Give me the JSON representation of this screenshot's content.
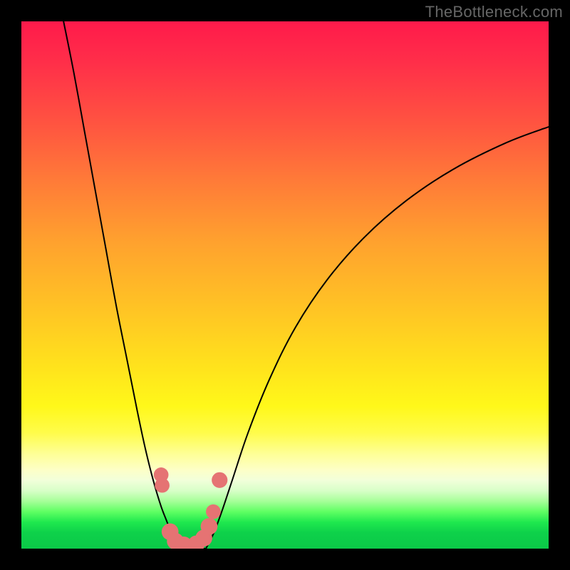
{
  "watermark": "TheBottleneck.com",
  "chart_data": {
    "type": "line",
    "title": "",
    "xlabel": "",
    "ylabel": "",
    "xlim": [
      0,
      100
    ],
    "ylim": [
      0,
      100
    ],
    "grid": false,
    "legend": false,
    "gradient_stops": [
      {
        "pos": 0,
        "color": "#ff1a4b"
      },
      {
        "pos": 8,
        "color": "#ff2f49"
      },
      {
        "pos": 20,
        "color": "#ff5640"
      },
      {
        "pos": 30,
        "color": "#ff7a38"
      },
      {
        "pos": 42,
        "color": "#ffa22e"
      },
      {
        "pos": 55,
        "color": "#ffc524"
      },
      {
        "pos": 66,
        "color": "#ffe41c"
      },
      {
        "pos": 73,
        "color": "#fff81a"
      },
      {
        "pos": 78,
        "color": "#fffc4a"
      },
      {
        "pos": 82,
        "color": "#feff96"
      },
      {
        "pos": 85,
        "color": "#fdffc6"
      },
      {
        "pos": 87,
        "color": "#f2ffda"
      },
      {
        "pos": 89,
        "color": "#d8ffc8"
      },
      {
        "pos": 91,
        "color": "#a6ff99"
      },
      {
        "pos": 93,
        "color": "#5fff63"
      },
      {
        "pos": 95,
        "color": "#1fe84e"
      },
      {
        "pos": 97,
        "color": "#0ed14a"
      },
      {
        "pos": 100,
        "color": "#0bc948"
      }
    ],
    "series": [
      {
        "name": "left-curve",
        "x": [
          8,
          10,
          12,
          14,
          16,
          18,
          20,
          22,
          23.5,
          25,
          26.5,
          28,
          29
        ],
        "y": [
          100,
          90,
          79,
          68,
          57,
          46,
          36,
          26,
          19,
          13,
          8,
          4,
          0
        ]
      },
      {
        "name": "right-curve",
        "x": [
          35,
          36.5,
          38,
          40,
          43,
          47,
          52,
          58,
          65,
          73,
          82,
          92,
          100
        ],
        "y": [
          0,
          3,
          7,
          13,
          22,
          32,
          42,
          51,
          59,
          66,
          72,
          77,
          80
        ]
      },
      {
        "name": "bottom-bridge",
        "x": [
          29,
          31,
          33,
          35
        ],
        "y": [
          0,
          0,
          0,
          0
        ]
      }
    ],
    "markers": [
      {
        "x": 26.5,
        "y": 14,
        "r": 1.4
      },
      {
        "x": 26.7,
        "y": 12,
        "r": 1.4
      },
      {
        "x": 28.2,
        "y": 3.2,
        "r": 1.6
      },
      {
        "x": 29.2,
        "y": 1.4,
        "r": 1.6
      },
      {
        "x": 30.8,
        "y": 0.7,
        "r": 1.6
      },
      {
        "x": 33.2,
        "y": 0.9,
        "r": 1.6
      },
      {
        "x": 34.6,
        "y": 2.0,
        "r": 1.6
      },
      {
        "x": 35.6,
        "y": 4.2,
        "r": 1.6
      },
      {
        "x": 36.4,
        "y": 7.0,
        "r": 1.4
      },
      {
        "x": 37.6,
        "y": 13.0,
        "r": 1.5
      }
    ],
    "marker_color": "#e57373",
    "curve_color": "#000000"
  }
}
